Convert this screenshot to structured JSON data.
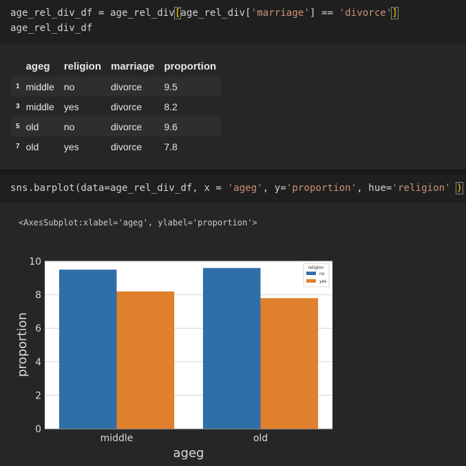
{
  "cell1": {
    "line1_prefix": "age_rel_div_df = age_rel_div",
    "line1_bracket_open": "[",
    "line1_mid": "age_rel_div[",
    "line1_key": "'marriage'",
    "line1_eq": "] == ",
    "line1_val": "'divorce'",
    "line1_bracket_close": "]",
    "line2": "age_rel_div_df"
  },
  "table": {
    "columns": [
      "",
      "ageg",
      "religion",
      "marriage",
      "proportion"
    ],
    "rows": [
      {
        "index": "1",
        "ageg": "middle",
        "religion": "no",
        "marriage": "divorce",
        "proportion": "9.5"
      },
      {
        "index": "3",
        "ageg": "middle",
        "religion": "yes",
        "marriage": "divorce",
        "proportion": "8.2"
      },
      {
        "index": "5",
        "ageg": "old",
        "religion": "no",
        "marriage": "divorce",
        "proportion": "9.6"
      },
      {
        "index": "7",
        "ageg": "old",
        "religion": "yes",
        "marriage": "divorce",
        "proportion": "7.8"
      }
    ]
  },
  "cell2": {
    "prefix": "sns.barplot(data=age_rel_div_df, x = ",
    "x_val": "'ageg'",
    "mid1": ", y=",
    "y_val": "'proportion'",
    "mid2": ", hue=",
    "hue_val": "'religion'",
    "suffix": " ",
    "close": ")"
  },
  "output_repr": "<AxesSubplot:xlabel='ageg', ylabel='proportion'>",
  "colors": {
    "no": "#2f6fa8",
    "yes": "#e07f2c"
  },
  "chart_data": {
    "type": "bar",
    "categories": [
      "middle",
      "old"
    ],
    "series": [
      {
        "name": "no",
        "values": [
          9.5,
          9.6
        ]
      },
      {
        "name": "yes",
        "values": [
          8.2,
          7.8
        ]
      }
    ],
    "xlabel": "ageg",
    "ylabel": "proportion",
    "ylim": [
      0,
      10
    ],
    "yticks": [
      "0",
      "2",
      "4",
      "6",
      "8",
      "10"
    ],
    "legend_title": "religion",
    "legend_position": "top-right",
    "grid": true
  }
}
